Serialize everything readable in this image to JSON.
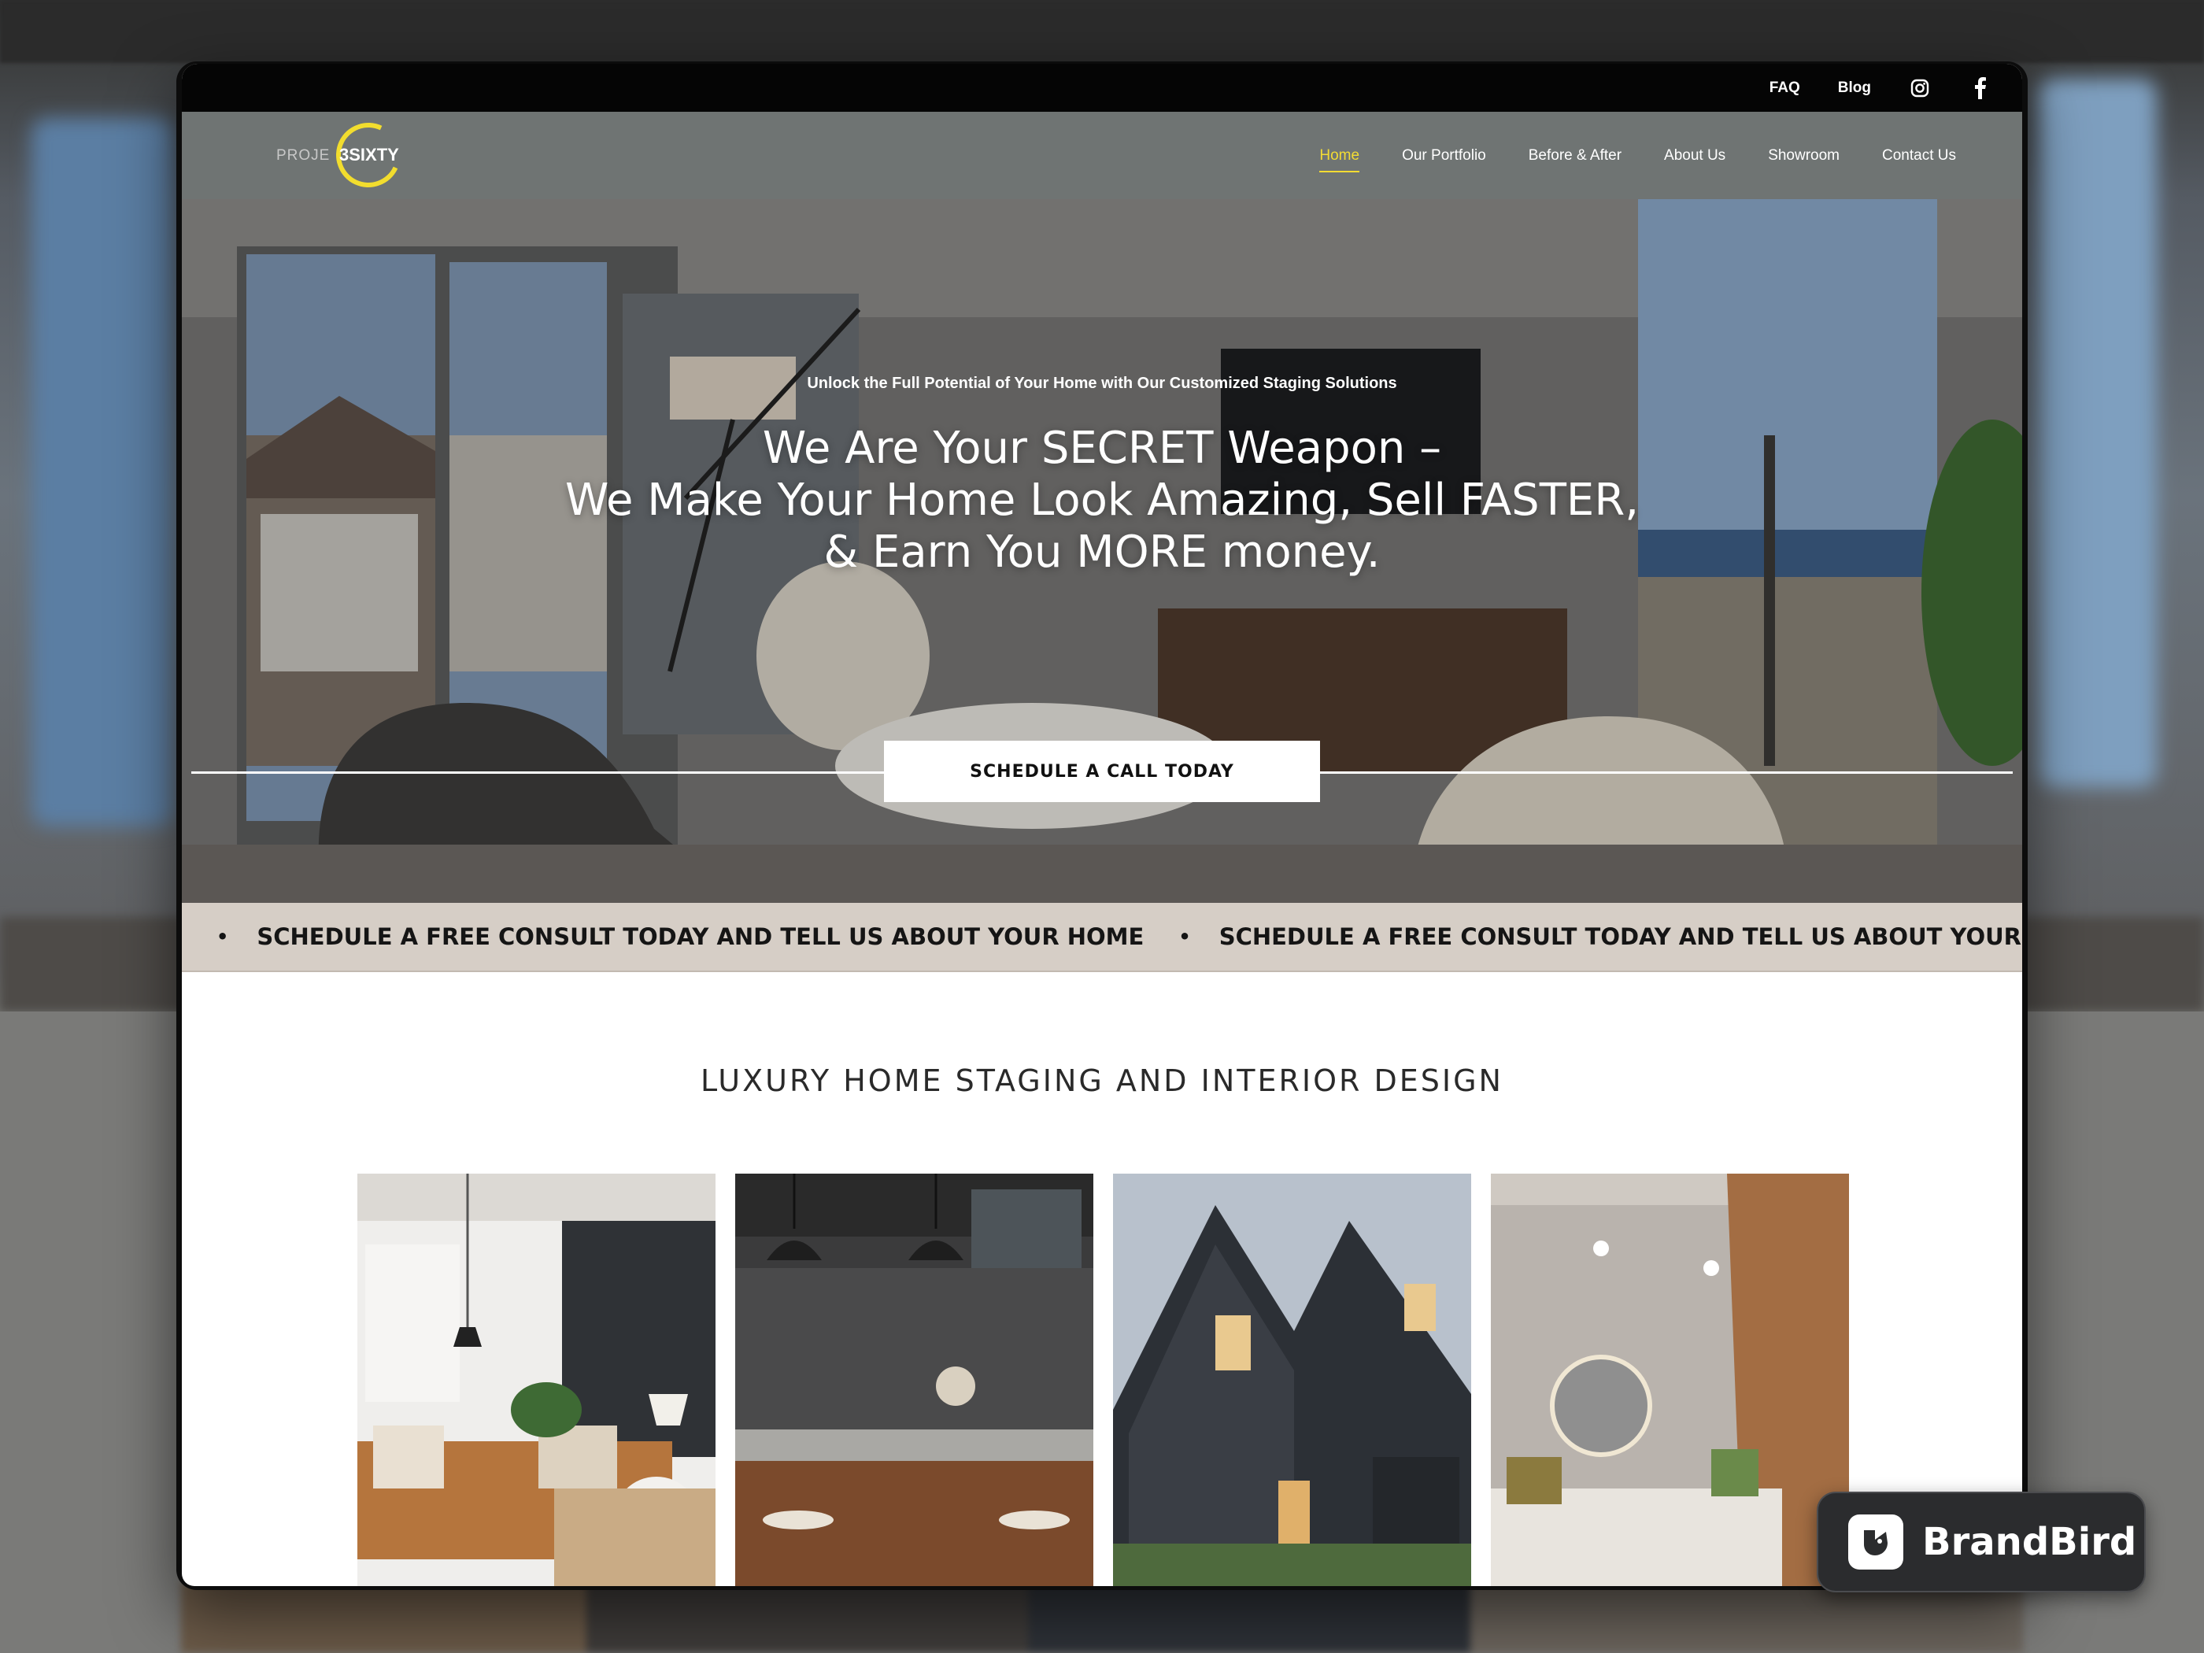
{
  "utility_nav": {
    "faq": "FAQ",
    "blog": "Blog",
    "social": [
      "instagram-icon",
      "facebook-icon"
    ]
  },
  "brand": {
    "logo_part1": "PROJE",
    "logo_part2": "3SIXTY"
  },
  "nav": {
    "items": [
      "Home",
      "Our Portfolio",
      "Before & After",
      "About Us",
      "Showroom",
      "Contact Us"
    ],
    "active": "Home",
    "accent": "#f3dc33"
  },
  "hero": {
    "kicker": "Unlock the Full Potential of Your Home with Our Customized Staging Solutions",
    "headline_line1": "We Are Your SECRET Weapon –",
    "headline_line2": "We Make Your Home Look Amazing, Sell FASTER,",
    "headline_line3": "& Earn You MORE money.",
    "cta": "SCHEDULE A CALL TODAY"
  },
  "marquee": {
    "text": "SCHEDULE A FREE CONSULT TODAY AND TELL US ABOUT YOUR HOME",
    "separator": "•",
    "background": "#d6cec6"
  },
  "section": {
    "title": "LUXURY HOME STAGING AND INTERIOR DESIGN"
  },
  "gallery": [
    "living-room-photo",
    "kitchen-photo",
    "house-exterior-photo",
    "bedroom-photo"
  ],
  "badge": {
    "label": "BrandBird"
  }
}
